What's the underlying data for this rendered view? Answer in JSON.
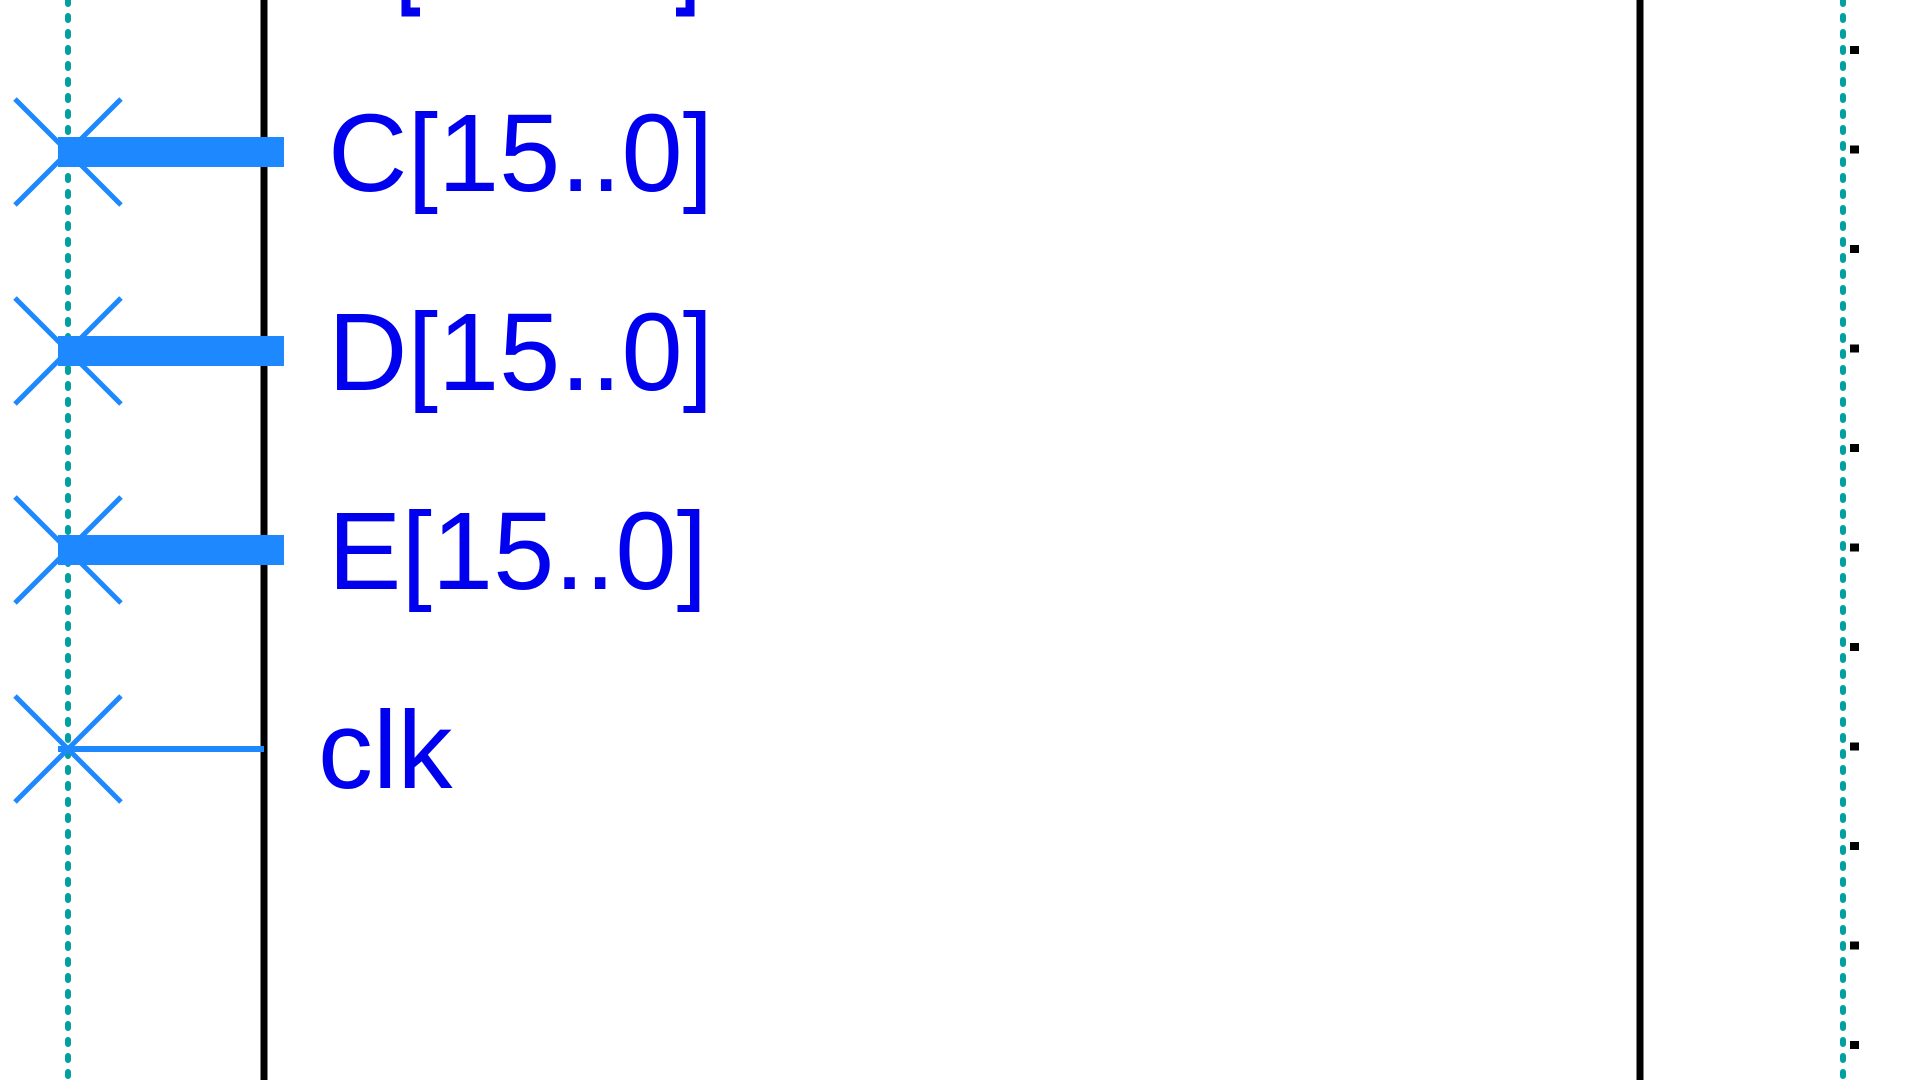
{
  "colors": {
    "background": "#ffffff",
    "pin_color": "#0000ee",
    "bus_color": "#1e88ff",
    "marker_color": "#1e88ff",
    "block_border": "#000000",
    "guide_line_color": "#00a0a0",
    "grid_dot_color": "#000000"
  },
  "icons": {
    "unconnected_marker": "x-marker-icon"
  },
  "pins": [
    {
      "label": "C[15..0]",
      "kind": "bus"
    },
    {
      "label": "D[15..0]",
      "kind": "bus"
    },
    {
      "label": "E[15..0]",
      "kind": "bus"
    },
    {
      "label": "clk",
      "kind": "wire"
    }
  ]
}
